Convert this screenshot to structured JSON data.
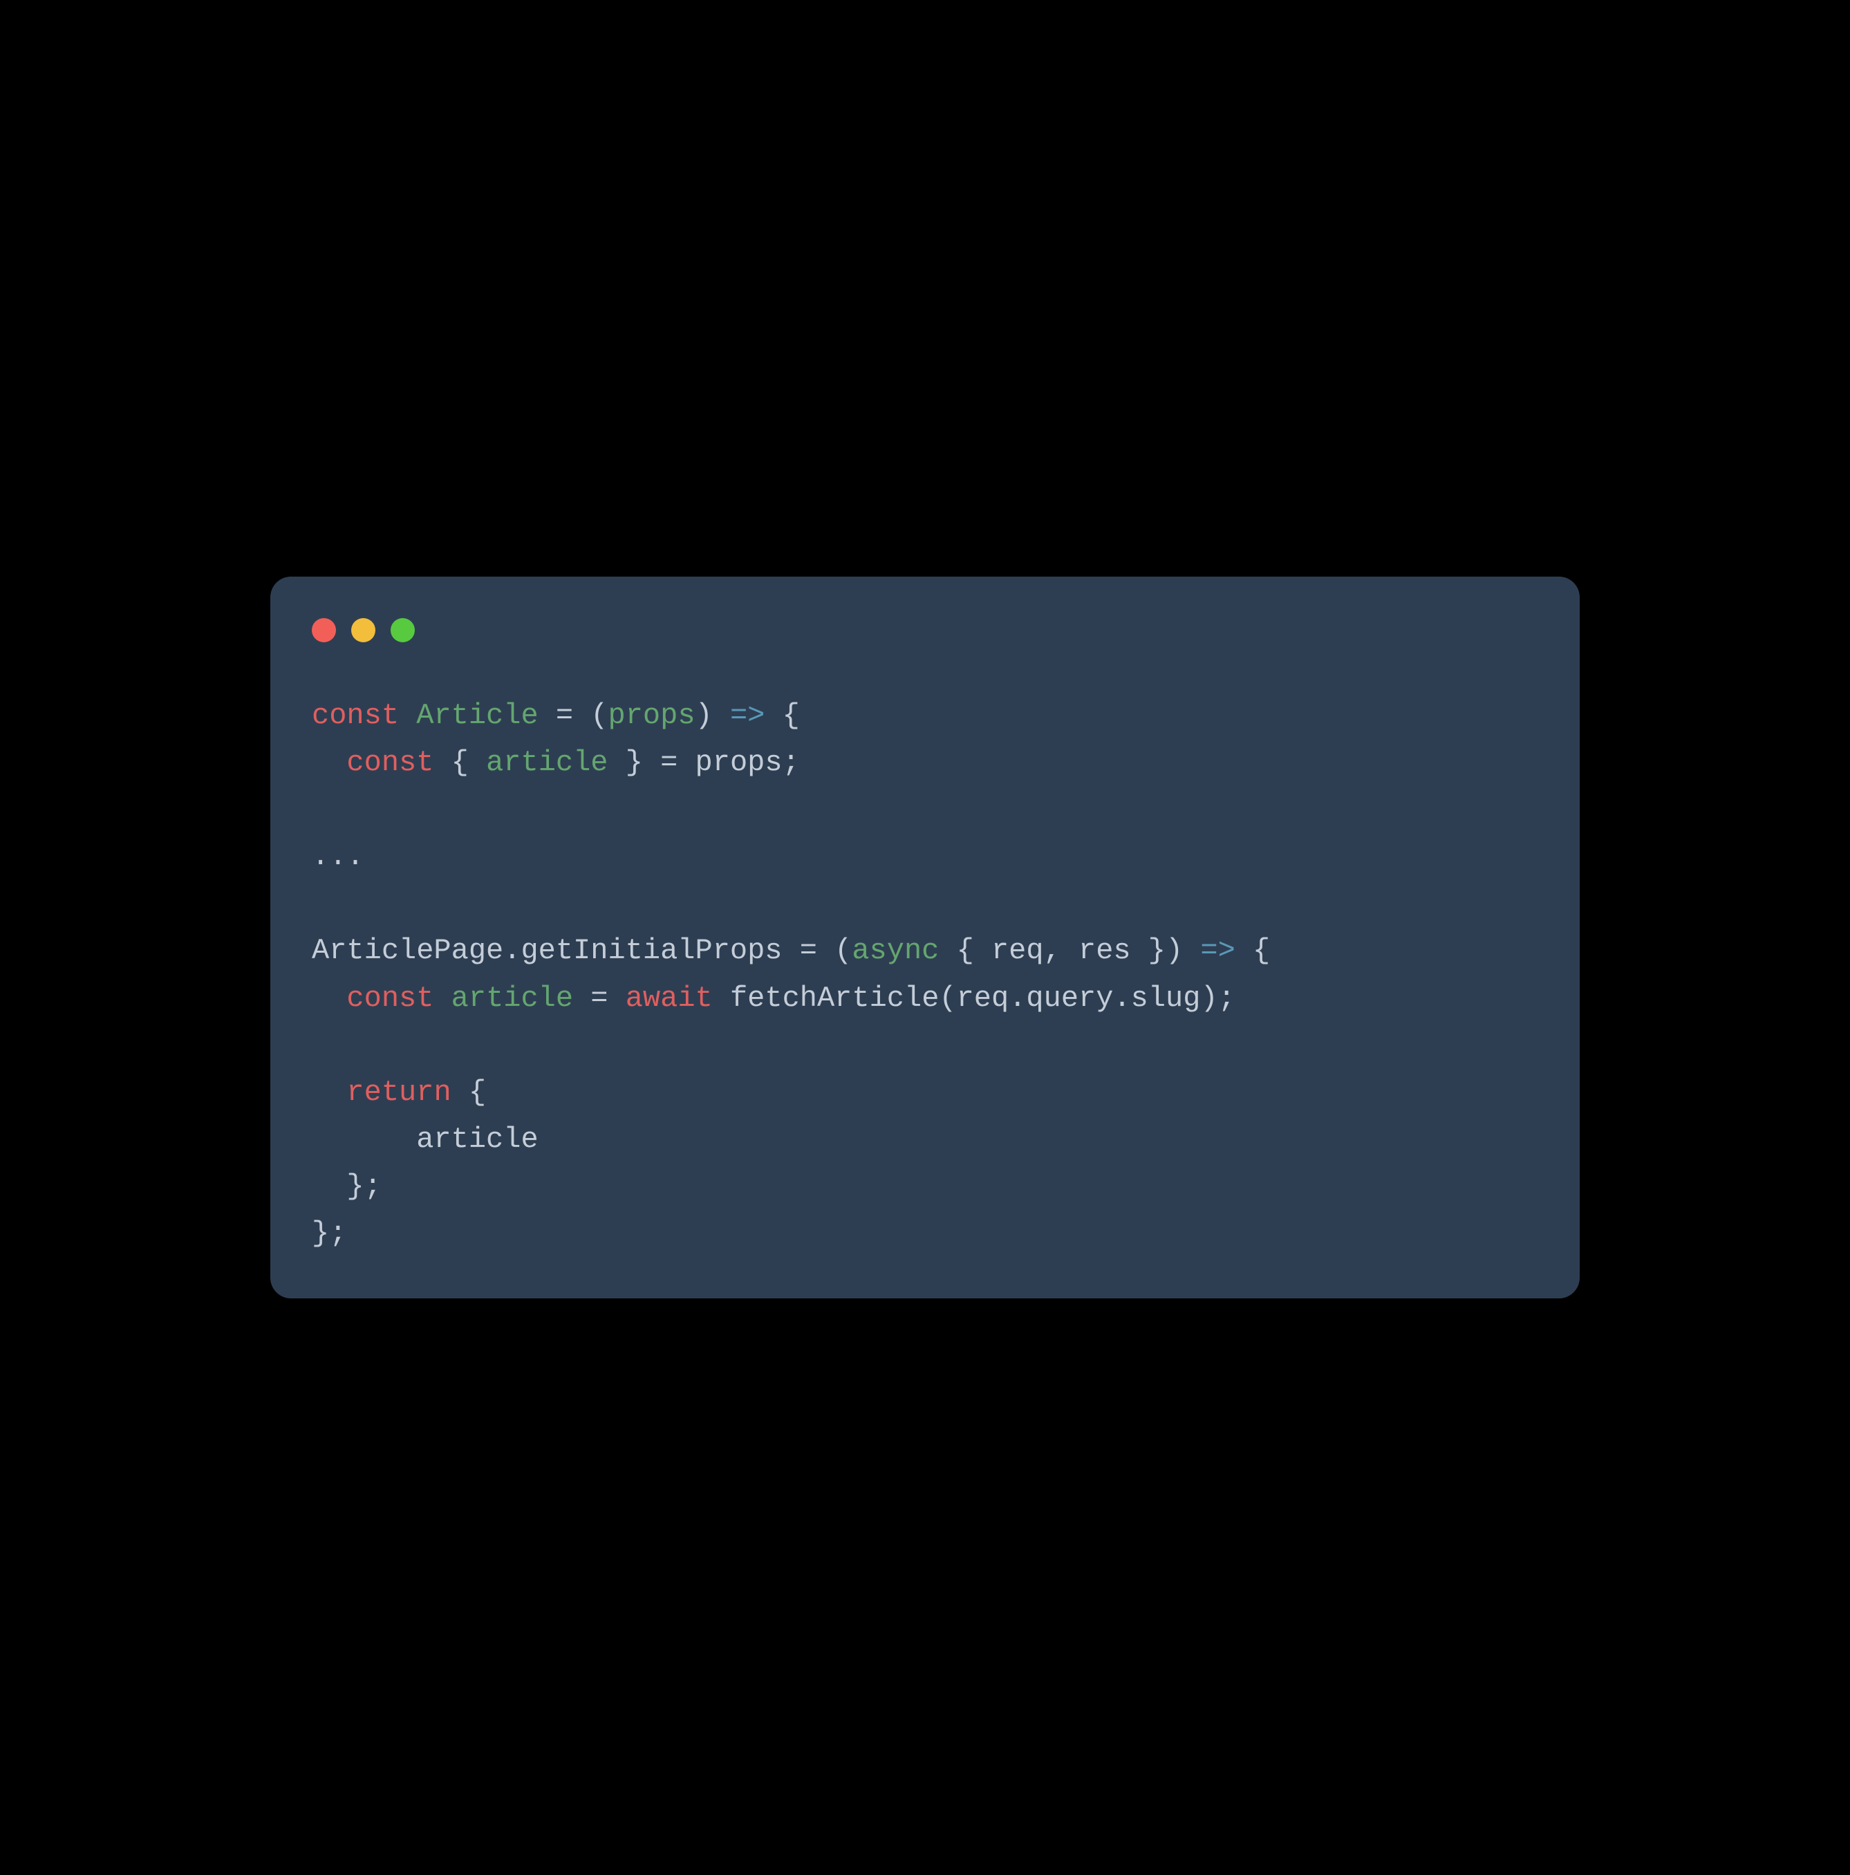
{
  "window": {
    "traffic_lights": {
      "close": "close",
      "minimize": "minimize",
      "maximize": "maximize"
    }
  },
  "code": {
    "lines": [
      [
        {
          "t": "const ",
          "c": "keyword"
        },
        {
          "t": "Article",
          "c": "type"
        },
        {
          "t": " = (",
          "c": "punc"
        },
        {
          "t": "props",
          "c": "param"
        },
        {
          "t": ") ",
          "c": "punc"
        },
        {
          "t": "=>",
          "c": "arrow"
        },
        {
          "t": " {",
          "c": "punc"
        }
      ],
      [
        {
          "t": "  ",
          "c": "punc"
        },
        {
          "t": "const",
          "c": "keyword"
        },
        {
          "t": " { ",
          "c": "punc"
        },
        {
          "t": "article",
          "c": "type"
        },
        {
          "t": " } = props;",
          "c": "punc"
        }
      ],
      [
        {
          "t": "",
          "c": "punc"
        }
      ],
      [
        {
          "t": "...",
          "c": "punc"
        }
      ],
      [
        {
          "t": "",
          "c": "punc"
        }
      ],
      [
        {
          "t": "ArticlePage.getInitialProps = (",
          "c": "ident"
        },
        {
          "t": "async",
          "c": "type"
        },
        {
          "t": " { req, res }) ",
          "c": "punc"
        },
        {
          "t": "=>",
          "c": "arrow"
        },
        {
          "t": " {",
          "c": "punc"
        }
      ],
      [
        {
          "t": "  ",
          "c": "punc"
        },
        {
          "t": "const ",
          "c": "keyword"
        },
        {
          "t": "article",
          "c": "type"
        },
        {
          "t": " = ",
          "c": "punc"
        },
        {
          "t": "await",
          "c": "keyword"
        },
        {
          "t": " fetchArticle(req.query.slug);",
          "c": "punc"
        }
      ],
      [
        {
          "t": "",
          "c": "punc"
        }
      ],
      [
        {
          "t": "  ",
          "c": "punc"
        },
        {
          "t": "return",
          "c": "keyword"
        },
        {
          "t": " {",
          "c": "punc"
        }
      ],
      [
        {
          "t": "      article",
          "c": "punc"
        }
      ],
      [
        {
          "t": "  };",
          "c": "punc"
        }
      ],
      [
        {
          "t": "};",
          "c": "punc"
        }
      ]
    ]
  }
}
